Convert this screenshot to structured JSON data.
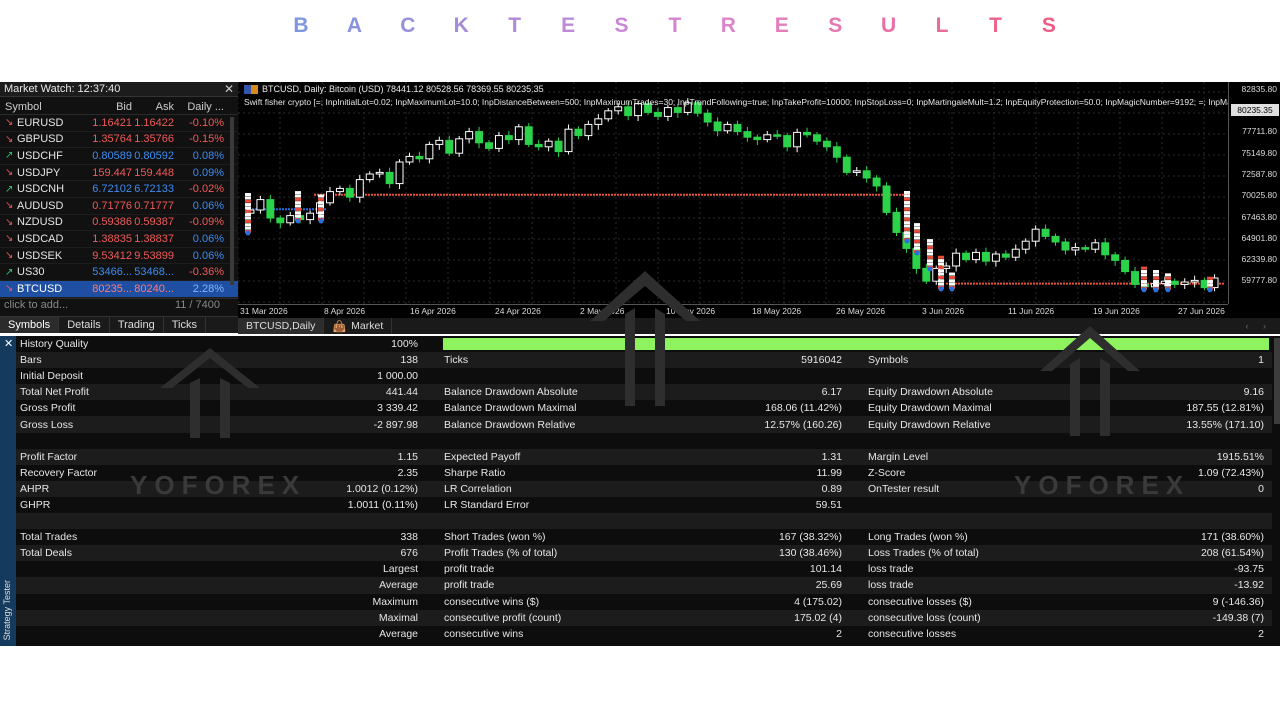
{
  "banner": {
    "letters": [
      "B",
      "A",
      "C",
      "K",
      "T",
      "E",
      "S",
      "T",
      "R",
      "E",
      "S",
      "U",
      "L",
      "T",
      "S"
    ],
    "colors": [
      "#7f96df",
      "#8b92dd",
      "#988fdb",
      "#a58cd9",
      "#b189d6",
      "#bd8ad5",
      "#c888d3",
      "#d386d0",
      "#dc85c8",
      "#e37ebd",
      "#e677b2",
      "#e870a6",
      "#ea6a9a",
      "#ec638e",
      "#ee5c82"
    ]
  },
  "market_watch": {
    "title": "Market Watch: 12:37:40",
    "columns": [
      "Symbol",
      "Bid",
      "Ask",
      "Daily ..."
    ],
    "rows": [
      {
        "symbol": "EURUSD",
        "bid": "1.16421",
        "ask": "1.16422",
        "change": "-0.10%",
        "dir": "down"
      },
      {
        "symbol": "GBPUSD",
        "bid": "1.35764",
        "ask": "1.35766",
        "change": "-0.15%",
        "dir": "down"
      },
      {
        "symbol": "USDCHF",
        "bid": "0.80589",
        "ask": "0.80592",
        "change": "0.08%",
        "dir": "up"
      },
      {
        "symbol": "USDJPY",
        "bid": "159.447",
        "ask": "159.448",
        "change": "0.09%",
        "dir": "down"
      },
      {
        "symbol": "USDCNH",
        "bid": "6.72102",
        "ask": "6.72133",
        "change": "-0.02%",
        "dir": "up"
      },
      {
        "symbol": "AUDUSD",
        "bid": "0.71776",
        "ask": "0.71777",
        "change": "0.06%",
        "dir": "down"
      },
      {
        "symbol": "NZDUSD",
        "bid": "0.59386",
        "ask": "0.59387",
        "change": "-0.09%",
        "dir": "down"
      },
      {
        "symbol": "USDCAD",
        "bid": "1.38835",
        "ask": "1.38837",
        "change": "0.06%",
        "dir": "down"
      },
      {
        "symbol": "USDSEK",
        "bid": "9.53412",
        "ask": "9.53899",
        "change": "0.06%",
        "dir": "down"
      },
      {
        "symbol": "US30",
        "bid": "53466...",
        "ask": "53468...",
        "change": "-0.36%",
        "dir": "up"
      },
      {
        "symbol": "BTCUSD",
        "bid": "80235...",
        "ask": "80240...",
        "change": "2.28%",
        "dir": "down",
        "selected": true
      }
    ],
    "add_text": "click to add...",
    "count": "11 / 7400",
    "tabs": [
      "Symbols",
      "Details",
      "Trading",
      "Ticks"
    ]
  },
  "chart": {
    "info_line1": "BTCUSD, Daily:  Bitcoin (USD)  78441.12 80528.56 78369.55 80235.35",
    "info_line2": "Swift fisher crypto [=; InpInitialLot=0.02; InpMaximumLot=10.0; InpDistanceBetween=500; InpMaximumTrades=30; InpTrendFollowing=true; InpTakeProfit=10000; InpStopLoss=0; InpMartingaleMult=1.2; InpEquityProtection=50.0; InpMagicNumber=9192; =; InpMax",
    "price_labels": [
      "82835.80",
      "80235.35",
      "77711.80",
      "75149.80",
      "72587.80",
      "70025.80",
      "67463.80",
      "64901.80",
      "62339.80",
      "59777.80"
    ],
    "current_price": "80235.35",
    "date_labels": [
      "31 Mar 2026",
      "8 Apr 2026",
      "16 Apr 2026",
      "24 Apr 2026",
      "2 May 2026",
      "10 May 2026",
      "18 May 2026",
      "26 May 2026",
      "3 Jun 2026",
      "11 Jun 2026",
      "19 Jun 2026",
      "27 Jun 2026"
    ],
    "colors": {
      "bull": "#ffffff",
      "bear": "#2bd24a",
      "sell_marker": "#e84f3a",
      "buy_marker": "#2a6fe0"
    }
  },
  "chart_data": {
    "type": "candlestick",
    "symbol": "BTCUSD",
    "timeframe": "Daily",
    "ylim": [
      58500,
      83500
    ],
    "x_range": [
      "31 Mar 2026",
      "30 Jun 2026"
    ],
    "closes": [
      68500,
      69800,
      67500,
      66900,
      67800,
      67300,
      68100,
      69400,
      70800,
      71200,
      70100,
      72300,
      73000,
      73200,
      71800,
      74500,
      75200,
      74900,
      76700,
      77200,
      75600,
      77400,
      78300,
      76900,
      76200,
      77800,
      77300,
      78900,
      76700,
      76400,
      77100,
      75800,
      78600,
      77800,
      79200,
      79900,
      80900,
      81400,
      80300,
      81800,
      80700,
      80200,
      81300,
      80700,
      81900,
      80600,
      79500,
      78400,
      79200,
      78300,
      77600,
      77300,
      77900,
      77800,
      76400,
      78200,
      77900,
      77100,
      76400,
      75100,
      73200,
      73400,
      72500,
      71500,
      68200,
      65700,
      63700,
      61200,
      59600,
      61200,
      61500,
      63100,
      62300,
      63200,
      62100,
      63000,
      62600,
      63600,
      64600,
      66100,
      65200,
      64500,
      63500,
      63800,
      63600,
      64400,
      62900,
      62200,
      60800,
      59200,
      58900,
      59300,
      59600,
      59200,
      59500,
      59700,
      58800,
      60000
    ]
  },
  "chart_tabs": [
    "BTCUSD,Daily",
    "Market"
  ],
  "tester": {
    "side_label": "Strategy Tester",
    "history_quality_label": "History Quality",
    "history_quality_value": "100%",
    "history_quality_fraction": 1.0,
    "rows": [
      [
        "Bars",
        "138",
        "Ticks",
        "5916042",
        "Symbols",
        "1"
      ],
      [
        "Initial Deposit",
        "1 000.00",
        "",
        "",
        "",
        ""
      ],
      [
        "Total Net Profit",
        "441.44",
        "Balance Drawdown Absolute",
        "6.17",
        "Equity Drawdown Absolute",
        "9.16"
      ],
      [
        "Gross Profit",
        "3 339.42",
        "Balance Drawdown Maximal",
        "168.06 (11.42%)",
        "Equity Drawdown Maximal",
        "187.55 (12.81%)"
      ],
      [
        "Gross Loss",
        "-2 897.98",
        "Balance Drawdown Relative",
        "12.57% (160.26)",
        "Equity Drawdown Relative",
        "13.55% (171.10)"
      ],
      [
        "",
        "",
        "",
        "",
        "",
        ""
      ],
      [
        "Profit Factor",
        "1.15",
        "Expected Payoff",
        "1.31",
        "Margin Level",
        "1915.51%"
      ],
      [
        "Recovery Factor",
        "2.35",
        "Sharpe Ratio",
        "11.99",
        "Z-Score",
        "1.09 (72.43%)"
      ],
      [
        "AHPR",
        "1.0012 (0.12%)",
        "LR Correlation",
        "0.89",
        "OnTester result",
        "0"
      ],
      [
        "GHPR",
        "1.0011 (0.11%)",
        "LR Standard Error",
        "59.51",
        "",
        ""
      ],
      [
        "",
        "",
        "",
        "",
        "",
        ""
      ],
      [
        "Total Trades",
        "338",
        "Short Trades (won %)",
        "167 (38.32%)",
        "Long Trades (won %)",
        "171 (38.60%)"
      ],
      [
        "Total Deals",
        "676",
        "Profit Trades (% of total)",
        "130 (38.46%)",
        "Loss Trades (% of total)",
        "208 (61.54%)"
      ],
      [
        "",
        "Largest",
        "profit trade",
        "101.14",
        "loss trade",
        "-93.75"
      ],
      [
        "",
        "Average",
        "profit trade",
        "25.69",
        "loss trade",
        "-13.92"
      ],
      [
        "",
        "Maximum",
        "consecutive wins ($)",
        "4 (175.02)",
        "consecutive losses ($)",
        "9 (-146.36)"
      ],
      [
        "",
        "Maximal",
        "consecutive profit (count)",
        "175.02 (4)",
        "consecutive loss (count)",
        "-149.38 (7)"
      ],
      [
        "",
        "Average",
        "consecutive wins",
        "2",
        "consecutive losses",
        "2"
      ]
    ]
  },
  "watermark": {
    "text": "YOFOREX"
  }
}
